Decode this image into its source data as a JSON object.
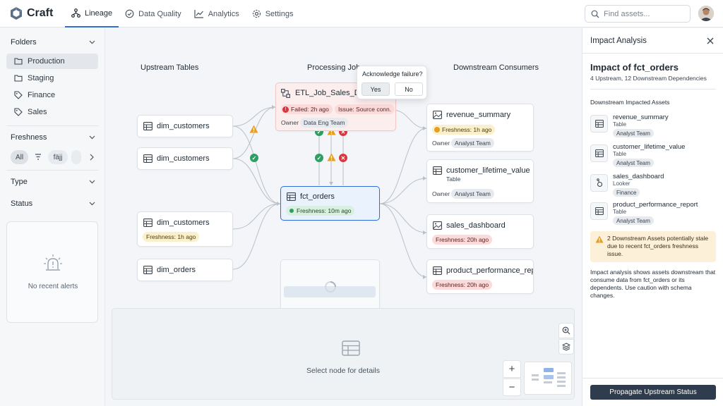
{
  "app": {
    "name": "Craft"
  },
  "nav": [
    {
      "label": "Lineage",
      "icon": "lineage-icon",
      "active": true
    },
    {
      "label": "Data Quality",
      "icon": "check-circle-icon",
      "active": false
    },
    {
      "label": "Analytics",
      "icon": "analytics-icon",
      "active": false
    },
    {
      "label": "Settings",
      "icon": "gear-icon",
      "active": false
    }
  ],
  "search": {
    "placeholder": "Find assets..."
  },
  "sidebar": {
    "folders_label": "Folders",
    "folders": [
      "Production",
      "Staging",
      "Finance",
      "Sales"
    ],
    "freshness_label": "Freshness",
    "freshness_pills": [
      "All",
      "fäjj"
    ],
    "type_label": "Type",
    "status_label": "Status",
    "alerts_empty": "No recent alerts"
  },
  "lineage": {
    "columns": [
      "Upstream Tables",
      "Processing Jobs",
      "Downstream Consumers"
    ],
    "upstream": [
      {
        "name": "dim_customers",
        "badge": null
      },
      {
        "name": "dim_customers",
        "badge": null
      },
      {
        "name": "dim_customers",
        "badge": "Freshness: 1h ago"
      },
      {
        "name": "dim_orders",
        "badge": null
      }
    ],
    "job": {
      "name": "ETL_Job_Sales_Daily",
      "failed": "Failed: 2h ago",
      "issue": "Issue: Source conn.",
      "owner_label": "Owner",
      "owner": "Data Eng Team"
    },
    "selected": {
      "name": "fct_orders",
      "badge": "Freshness: 10m ago"
    },
    "downstream": [
      {
        "name": "revenue_summary",
        "type": "",
        "badge": "Freshness: 1h ago",
        "owner": "Analyst Team"
      },
      {
        "name": "customer_lifetime_value",
        "type": "Table",
        "badge": "",
        "owner": "Analyst Team"
      },
      {
        "name": "sales_dashboard",
        "type": "",
        "badge": "Freshness: 20h ago",
        "owner": ""
      },
      {
        "name": "product_performance_report",
        "type": "",
        "badge": "Freshness: 20h ago",
        "owner": ""
      }
    ],
    "owner_label": "Owner"
  },
  "popup": {
    "title": "Acknowledge failure?",
    "yes": "Yes",
    "no": "No"
  },
  "details": {
    "empty": "Select node for details"
  },
  "panel": {
    "header": "Impact Analysis",
    "title": "Impact of fct_orders",
    "subtitle": "4 Upstream, 12 Downstream Dependencies",
    "section": "Downstream Impacted Assets",
    "assets": [
      {
        "name": "revenue_summary",
        "type": "Table",
        "team": "Analyst Team",
        "icon": "table-icon"
      },
      {
        "name": "customer_lifetime_value",
        "type": "Table",
        "team": "Analyst Team",
        "icon": "table-icon"
      },
      {
        "name": "sales_dashboard",
        "type": "Looker",
        "team": "Finance",
        "icon": "looker-icon"
      },
      {
        "name": "product_performance_report",
        "type": "Table",
        "team": "Analyst Team",
        "icon": "table-icon"
      }
    ],
    "warning": "2 Downstream Assets potentially stale due to recent fct_orders freshness issue.",
    "note": "Impact analysis shows assets downstream that consume data from fct_orders or its dependents. Use caution with schema changes.",
    "action": "Propagate Upstream Status"
  },
  "colors": {
    "accent": "#2f6fd6",
    "danger": "#d9363e",
    "warning": "#e6a020",
    "success": "#2e9e63",
    "primary_button": "#2f3c4e"
  }
}
